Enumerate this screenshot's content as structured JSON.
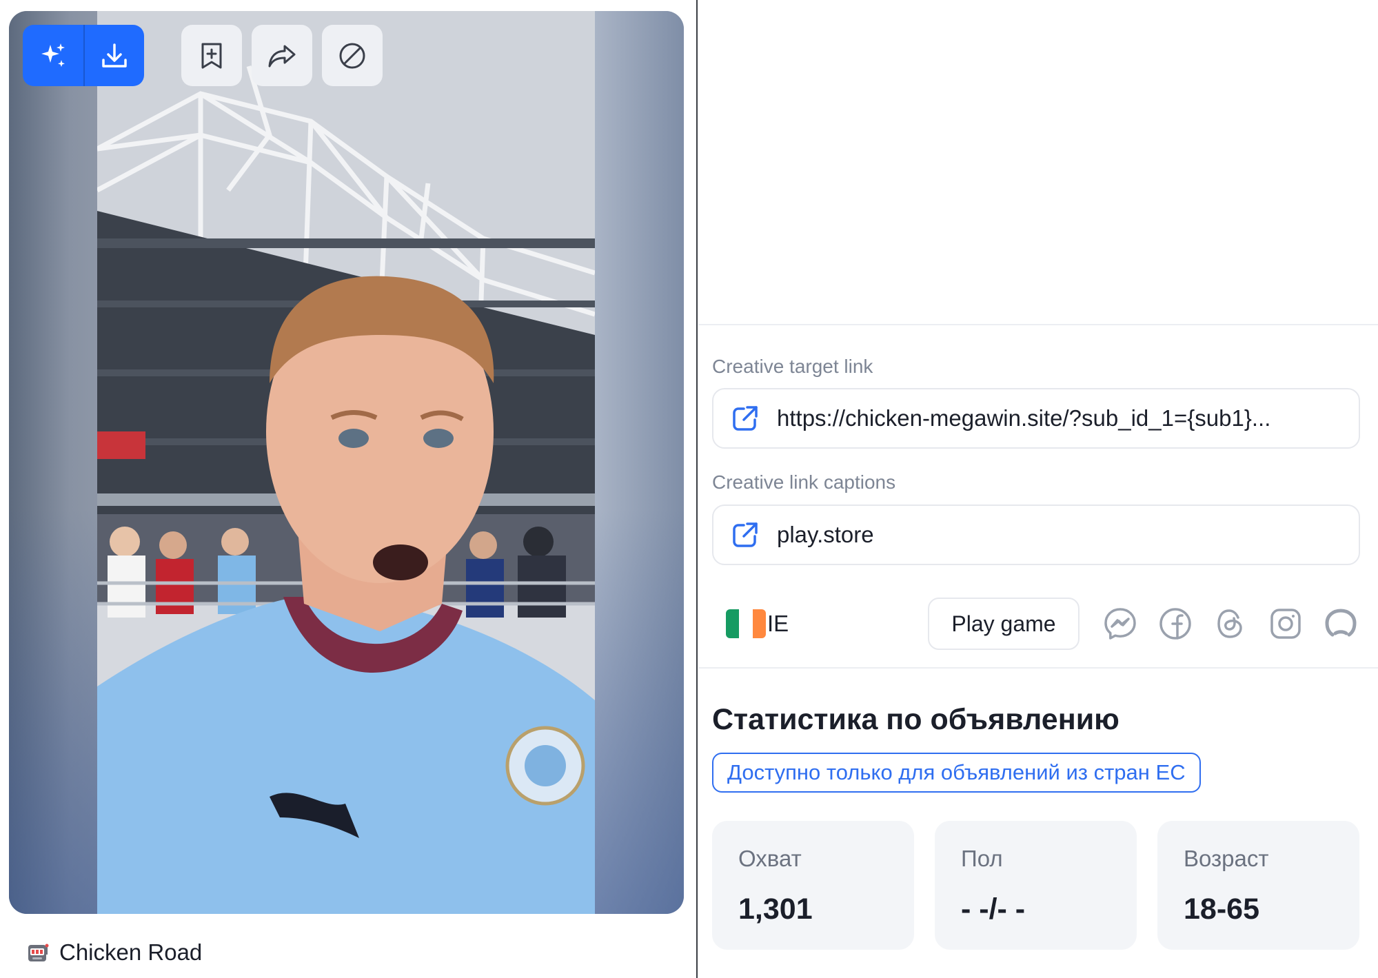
{
  "caption": {
    "icon": "slot-machine-icon",
    "label": "Chicken Road"
  },
  "toolbar": {
    "ai_icon": "sparkles-icon",
    "download_icon": "download-icon",
    "save_icon": "bookmark-add-icon",
    "share_icon": "share-icon",
    "block_icon": "block-icon"
  },
  "links": {
    "target_label": "Creative target link",
    "target_url": "https://chicken-megawin.site/?sub_id_1={sub1}...",
    "captions_label": "Creative link captions",
    "caption_value": "play.store"
  },
  "meta": {
    "country_code": "IE",
    "cta_label": "Play game",
    "platforms": [
      "messenger-icon",
      "facebook-icon",
      "threads-icon",
      "instagram-icon",
      "audience-network-icon"
    ]
  },
  "stats": {
    "title": "Статистика по объявлению",
    "badge": "Доступно только для объявлений из стран ЕС",
    "cards": [
      {
        "label": "Охват",
        "value": "1,301"
      },
      {
        "label": "Пол",
        "value": "- -/- -"
      },
      {
        "label": "Возраст",
        "value": "18-65"
      }
    ]
  },
  "colors": {
    "accent": "#1f6bff",
    "badge_blue": "#2f6ef0",
    "link_icon": "#2f6ef0",
    "platform_icon": "#9aa1ad",
    "card_bg": "#f3f5f8",
    "flag": [
      "#169b62",
      "#ffffff",
      "#ff883e"
    ]
  }
}
